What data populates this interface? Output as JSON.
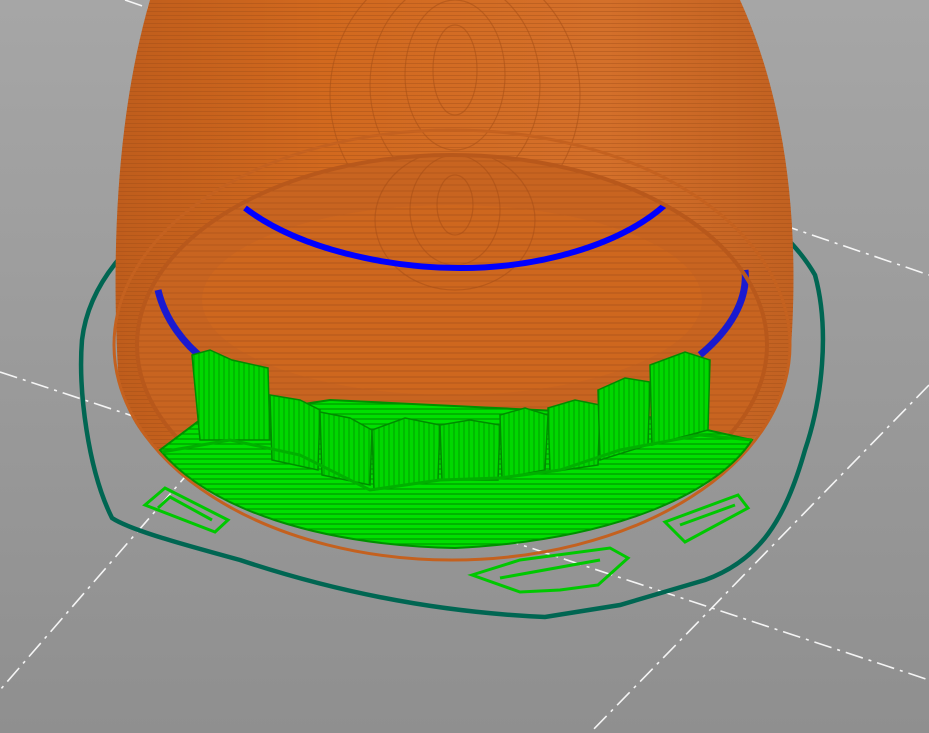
{
  "viewport": {
    "background": "#9a9a9a",
    "colors": {
      "bed_top": "#a6a6a6",
      "bed_bottom": "#8f8f8f",
      "bed_guide_lines": "#ffffff",
      "perimeter_outer": "#d2691e",
      "perimeter_shade": "#b4561a",
      "perimeter_highlight": "#e0803a",
      "overhang_perimeter": "#0000ff",
      "support_material": "#00ff00",
      "support_dark": "#00a800",
      "skirt_brim": "#006652"
    },
    "layers": [
      {
        "name": "skirt",
        "color_key": "skirt_brim"
      },
      {
        "name": "external-perimeter",
        "color_key": "perimeter_outer"
      },
      {
        "name": "overhang-perimeter",
        "color_key": "overhang_perimeter"
      },
      {
        "name": "support-material",
        "color_key": "support_material"
      }
    ]
  }
}
